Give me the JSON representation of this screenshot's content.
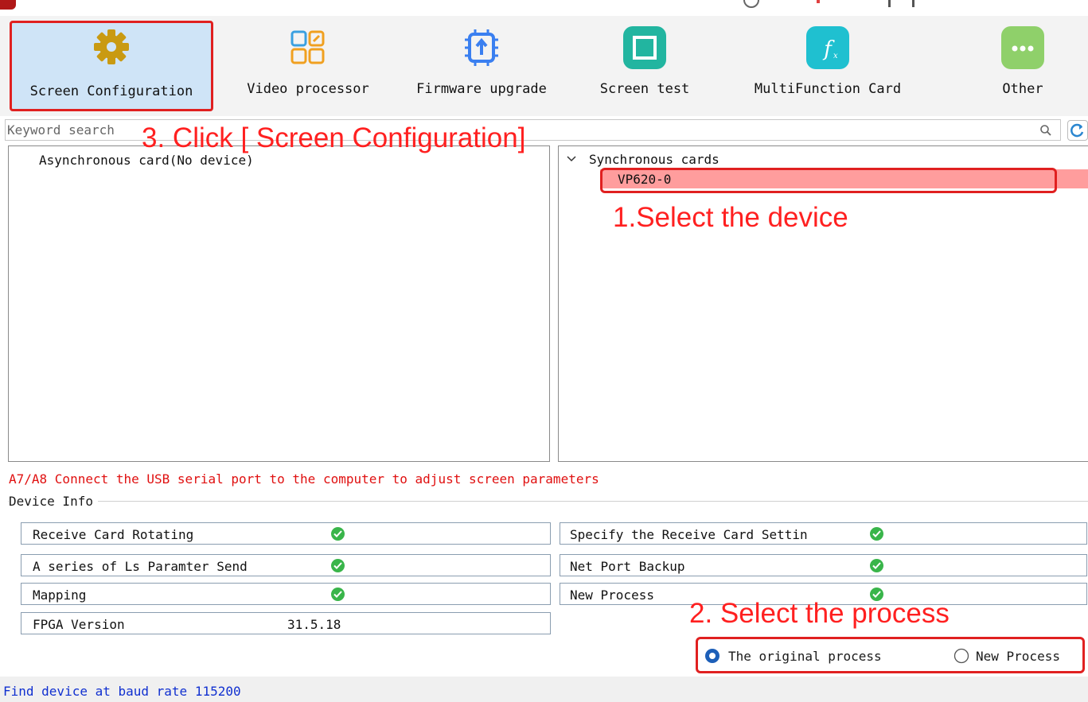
{
  "toolbar": {
    "items": [
      {
        "label": "Screen Configuration",
        "icon": "gear-icon",
        "color": "#d4a017",
        "selected": true
      },
      {
        "label": "Video processor",
        "icon": "grid-apps-icon",
        "color": "#f0a020"
      },
      {
        "label": "Firmware upgrade",
        "icon": "chip-upload-icon",
        "color": "#3a7ff0"
      },
      {
        "label": "Screen test",
        "icon": "screen-icon",
        "color": "#22b5a0"
      },
      {
        "label": "MultiFunction Card",
        "icon": "function-icon",
        "color": "#1fc0d0"
      },
      {
        "label": "Other",
        "icon": "more-icon",
        "color": "#8fd06a"
      }
    ]
  },
  "search": {
    "placeholder": "Keyword search"
  },
  "left_tree": {
    "item": "Asynchronous card(No device)"
  },
  "right_tree": {
    "group": "Synchronous cards",
    "selected_device": "VP620-0"
  },
  "annotations": {
    "step1": "1.Select the device",
    "step2": "2. Select the process",
    "step3": "3. Click [ Screen Configuration]"
  },
  "notice": "A7/A8 Connect the USB serial port to the computer to adjust screen parameters",
  "device_info": {
    "title": "Device Info",
    "left_rows": [
      {
        "label": "Receive Card Rotating",
        "status": "ok"
      },
      {
        "label": "A series of Ls Paramter Send",
        "status": "ok"
      },
      {
        "label": "Mapping",
        "status": "ok"
      }
    ],
    "fpga": {
      "label": "FPGA Version",
      "value": "31.5.18"
    },
    "right_rows": [
      {
        "label": "Specify the Receive Card Settin",
        "status": "ok"
      },
      {
        "label": "Net Port Backup",
        "status": "ok"
      },
      {
        "label": "New Process",
        "status": "ok"
      }
    ]
  },
  "process": {
    "options": [
      "The original process",
      "New Process"
    ],
    "selected": "The original process"
  },
  "status": "Find device at baud rate 115200",
  "colors": {
    "annotation_red": "#ff2020",
    "selected_row": "#ff9d9d",
    "notice_red": "#e01010",
    "status_blue": "#1030d0",
    "check_green": "#39b54a"
  }
}
